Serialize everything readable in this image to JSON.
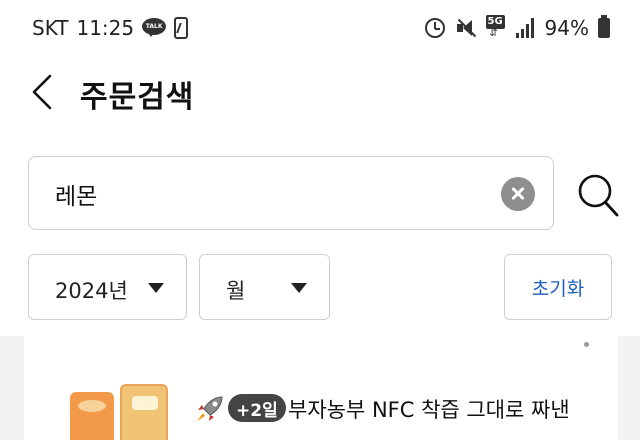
{
  "status_bar": {
    "carrier": "SKT",
    "time": "11:25",
    "talk_icon_text": "TALK",
    "network": "5G",
    "battery": "94%"
  },
  "header": {
    "title": "주문검색",
    "back_icon": "chevron-left-icon"
  },
  "search": {
    "value": "레몬",
    "placeholder": "",
    "clear_icon": "clear-circle-icon",
    "search_icon": "magnifier-icon"
  },
  "filters": {
    "year": "2024년",
    "month": "월",
    "reset_label": "초기화"
  },
  "order": {
    "eta_badge": "+2일",
    "product_title": "부자농부 NFC 착즙 그대로 짜낸"
  },
  "colors": {
    "accent": "#1f5fbf",
    "date_green": "#2aa84a",
    "badge_bg": "#444444"
  }
}
